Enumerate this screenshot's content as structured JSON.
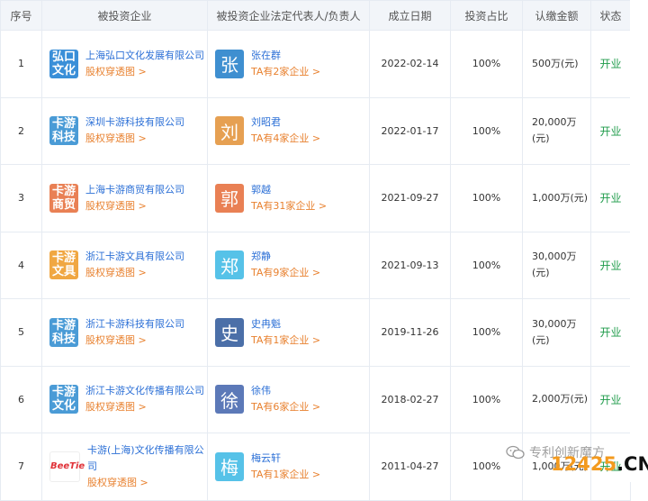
{
  "headers": [
    "序号",
    "被投资企业",
    "被投资企业法定代表人/负责人",
    "成立日期",
    "投资占比",
    "认缴金额",
    "状态"
  ],
  "equity_link_text": "股权穿透图 >",
  "rows": [
    {
      "no": "1",
      "logo": [
        "弘口",
        "文化"
      ],
      "logo_color": "#3a8fd8",
      "company": "上海弘口文化发展有限公司",
      "avatar": "张",
      "avatar_color": "#3f8fd0",
      "person": "张在群",
      "person_link": "TA有2家企业 >",
      "date": "2022-02-14",
      "pct": "100%",
      "amount": "500万(元)",
      "status": "开业"
    },
    {
      "no": "2",
      "logo": [
        "卡游",
        "科技"
      ],
      "logo_color": "#4a9bd6",
      "company": "深圳卡游科技有限公司",
      "avatar": "刘",
      "avatar_color": "#e6a052",
      "person": "刘昭君",
      "person_link": "TA有4家企业 >",
      "date": "2022-01-17",
      "pct": "100%",
      "amount": "20,000万(元)",
      "status": "开业"
    },
    {
      "no": "3",
      "logo": [
        "卡游",
        "商贸"
      ],
      "logo_color": "#e98054",
      "company": "上海卡游商贸有限公司",
      "avatar": "郭",
      "avatar_color": "#e98054",
      "person": "郭越",
      "person_link": "TA有31家企业 >",
      "date": "2021-09-27",
      "pct": "100%",
      "amount": "1,000万(元)",
      "status": "开业"
    },
    {
      "no": "4",
      "logo": [
        "卡游",
        "文具"
      ],
      "logo_color": "#f0a742",
      "company": "浙江卡游文具有限公司",
      "avatar": "郑",
      "avatar_color": "#56c2e8",
      "person": "郑静",
      "person_link": "TA有9家企业 >",
      "date": "2021-09-13",
      "pct": "100%",
      "amount": "30,000万(元)",
      "status": "开业"
    },
    {
      "no": "5",
      "logo": [
        "卡游",
        "科技"
      ],
      "logo_color": "#4a9bd6",
      "company": "浙江卡游科技有限公司",
      "avatar": "史",
      "avatar_color": "#4b6fa8",
      "person": "史冉魁",
      "person_link": "TA有1家企业 >",
      "date": "2019-11-26",
      "pct": "100%",
      "amount": "30,000万(元)",
      "status": "开业"
    },
    {
      "no": "6",
      "logo": [
        "卡游",
        "文化"
      ],
      "logo_color": "#4a9bd6",
      "company": "浙江卡游文化传播有限公司",
      "avatar": "徐",
      "avatar_color": "#5c79b8",
      "person": "徐伟",
      "person_link": "TA有6家企业 >",
      "date": "2018-02-27",
      "pct": "100%",
      "amount": "2,000万(元)",
      "status": "开业"
    },
    {
      "no": "7",
      "logo": [
        "BeeTie"
      ],
      "logo_color": "#ffffff",
      "company": "卡游(上海)文化传播有限公司",
      "avatar": "梅",
      "avatar_color": "#56c2e8",
      "person": "梅云轩",
      "person_link": "TA有1家企业 >",
      "date": "2011-04-27",
      "pct": "100%",
      "amount": "1,000万(元)",
      "status": "开业"
    }
  ],
  "watermark": {
    "text1": "专利创新魔方",
    "text2a": "12425",
    "text2b": ".CN"
  }
}
